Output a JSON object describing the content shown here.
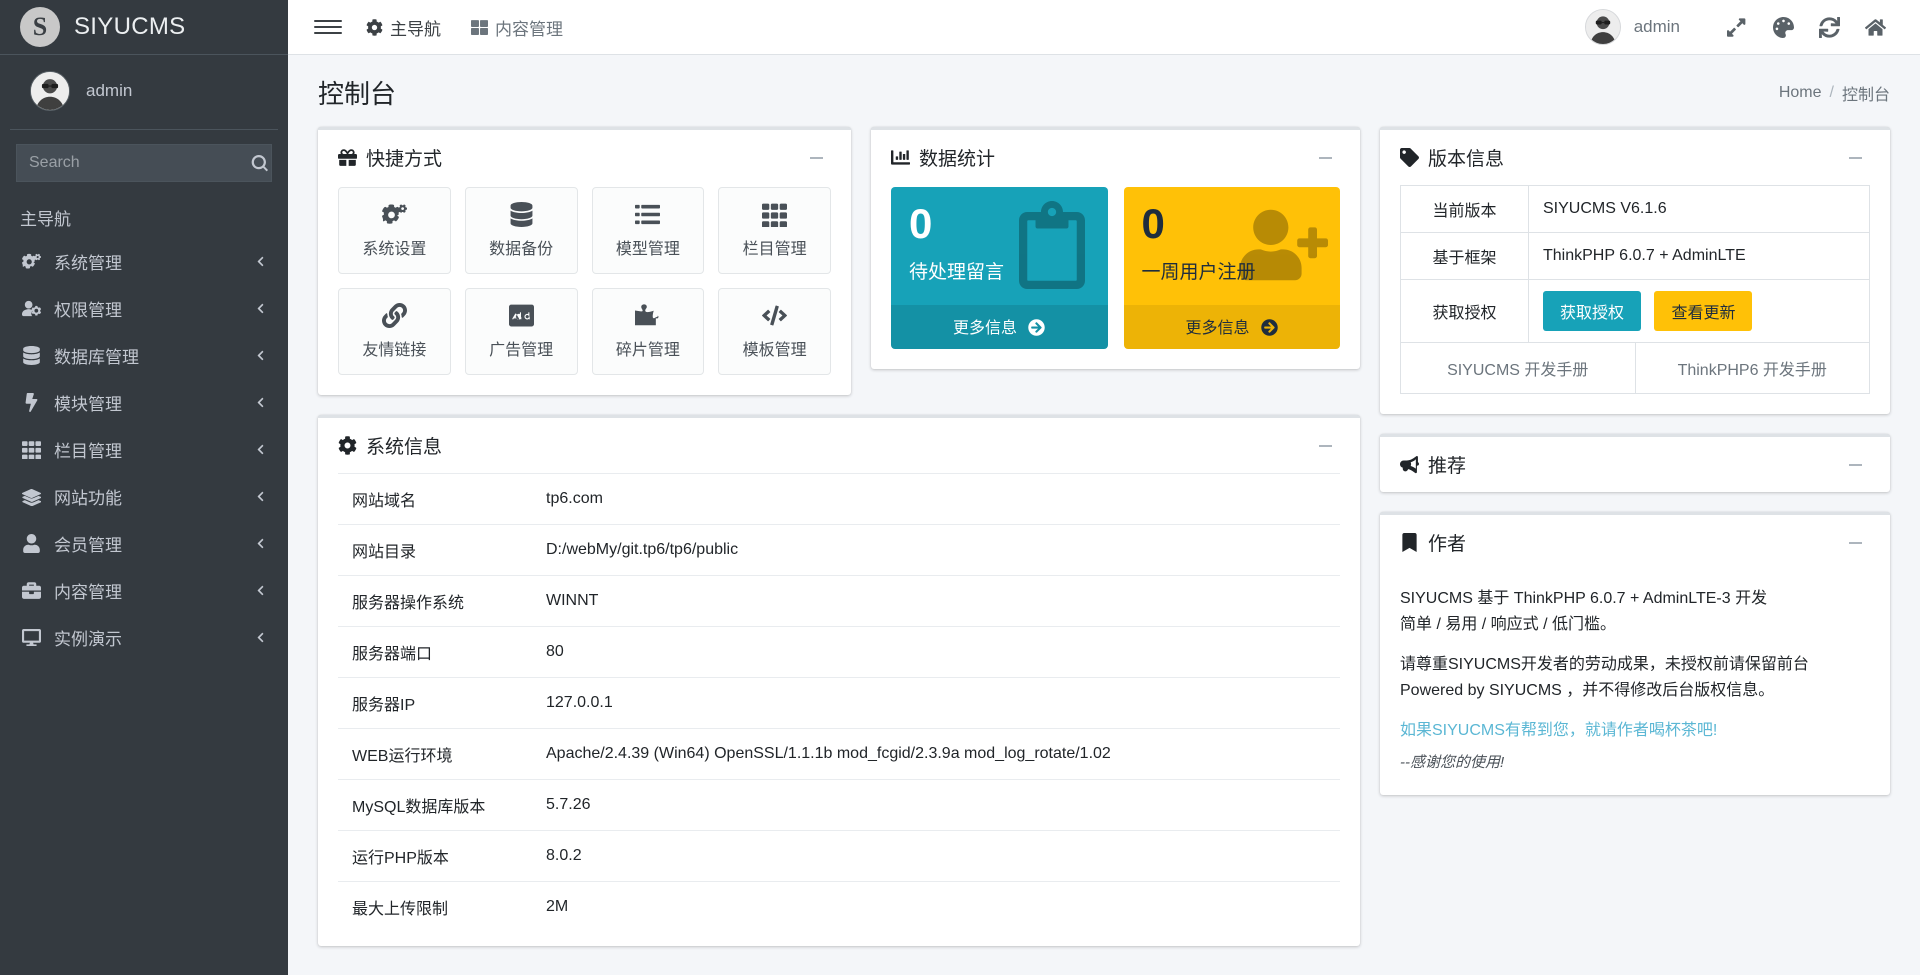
{
  "brand": {
    "logo_letter": "S",
    "name": "SIYUCMS"
  },
  "sidebar": {
    "user": {
      "name": "admin"
    },
    "search": {
      "placeholder": "Search",
      "value": "",
      "icon": "search-icon"
    },
    "nav_header": "主导航",
    "items": [
      {
        "label": "系统管理",
        "icon": "cogs-icon",
        "chevron": "chevron-left-icon"
      },
      {
        "label": "权限管理",
        "icon": "user-cog-icon",
        "chevron": "chevron-left-icon"
      },
      {
        "label": "数据库管理",
        "icon": "database-icon",
        "chevron": "chevron-left-icon"
      },
      {
        "label": "模块管理",
        "icon": "bolt-icon",
        "chevron": "chevron-left-icon"
      },
      {
        "label": "栏目管理",
        "icon": "grid-icon",
        "chevron": "chevron-left-icon"
      },
      {
        "label": "网站功能",
        "icon": "layers-icon",
        "chevron": "chevron-left-icon"
      },
      {
        "label": "会员管理",
        "icon": "user-icon",
        "chevron": "chevron-left-icon"
      },
      {
        "label": "内容管理",
        "icon": "briefcase-icon",
        "chevron": "chevron-left-icon"
      },
      {
        "label": "实例演示",
        "icon": "desktop-icon",
        "chevron": "chevron-left-icon"
      }
    ]
  },
  "topnav": {
    "menu_toggle": "hamburger-icon",
    "items": [
      {
        "label": "主导航",
        "icon": "gear-icon"
      },
      {
        "label": "内容管理",
        "icon": "th-large-icon"
      }
    ],
    "user": "admin",
    "actions": [
      {
        "name": "fullscreen-icon"
      },
      {
        "name": "palette-icon"
      },
      {
        "name": "refresh-icon"
      },
      {
        "name": "home-icon"
      }
    ]
  },
  "page": {
    "title": "控制台",
    "breadcrumb": {
      "home": "Home",
      "sep": "/",
      "current": "控制台"
    }
  },
  "shortcuts": {
    "title": "快捷方式",
    "title_icon": "gift-icon",
    "collapse": "minus-icon",
    "items": [
      {
        "label": "系统设置",
        "icon": "cogs-icon"
      },
      {
        "label": "数据备份",
        "icon": "database-icon"
      },
      {
        "label": "模型管理",
        "icon": "list-icon"
      },
      {
        "label": "栏目管理",
        "icon": "grid-icon"
      },
      {
        "label": "友情链接",
        "icon": "link-icon"
      },
      {
        "label": "广告管理",
        "icon": "ad-icon"
      },
      {
        "label": "碎片管理",
        "icon": "puzzle-icon"
      },
      {
        "label": "模板管理",
        "icon": "code-icon"
      }
    ]
  },
  "stats": {
    "title": "数据统计",
    "title_icon": "chart-bar-icon",
    "collapse": "minus-icon",
    "boxes": [
      {
        "value": "0",
        "label": "待处理留言",
        "footer": "更多信息",
        "footer_icon": "arrow-circle-right-icon",
        "color": "#17a2b8",
        "icon": "clipboard-icon"
      },
      {
        "value": "0",
        "label": "一周用户注册",
        "footer": "更多信息",
        "footer_icon": "arrow-circle-right-icon",
        "color": "#ffc107",
        "icon": "user-plus-icon"
      }
    ]
  },
  "version": {
    "title": "版本信息",
    "title_icon": "tag-icon",
    "collapse": "minus-icon",
    "rows": [
      {
        "label": "当前版本",
        "value": "SIYUCMS V6.1.6"
      },
      {
        "label": "基于框架",
        "value": "ThinkPHP 6.0.7 + AdminLTE"
      }
    ],
    "license_label": "获取授权",
    "license_button": "获取授权",
    "update_button": "查看更新",
    "manuals": [
      "SIYUCMS 开发手册",
      "ThinkPHP6 开发手册"
    ]
  },
  "sysinfo": {
    "title": "系统信息",
    "title_icon": "gear-icon",
    "collapse": "minus-icon",
    "rows": [
      {
        "key": "网站域名",
        "value": "tp6.com"
      },
      {
        "key": "网站目录",
        "value": "D:/webMy/git.tp6/tp6/public"
      },
      {
        "key": "服务器操作系统",
        "value": "WINNT"
      },
      {
        "key": "服务器端口",
        "value": "80"
      },
      {
        "key": "服务器IP",
        "value": "127.0.0.1"
      },
      {
        "key": "WEB运行环境",
        "value": "Apache/2.4.39 (Win64) OpenSSL/1.1.1b mod_fcgid/2.3.9a mod_log_rotate/1.02"
      },
      {
        "key": "MySQL数据库版本",
        "value": "5.7.26"
      },
      {
        "key": "运行PHP版本",
        "value": "8.0.2"
      },
      {
        "key": "最大上传限制",
        "value": "2M"
      }
    ]
  },
  "recommend": {
    "title": "推荐",
    "title_icon": "bullhorn-icon",
    "collapse": "minus-icon"
  },
  "author": {
    "title": "作者",
    "title_icon": "bookmark-icon",
    "collapse": "minus-icon",
    "line1": "SIYUCMS 基于 ThinkPHP 6.0.7 + AdminLTE-3 开发",
    "line2": "简单 / 易用 / 响应式 / 低门槛。",
    "paragraph": "请尊重SIYUCMS开发者的劳动成果，未授权前请保留前台 Powered by SIYUCMS ，并不得修改后台版权信息。",
    "link": "如果SIYUCMS有帮到您，就请作者喝杯茶吧!",
    "thanks": "--感谢您的使用!"
  },
  "colors": {
    "sidebar_bg": "#343a40",
    "teal": "#17a2b8",
    "yellow": "#ffc107",
    "page_bg": "#f4f6f9",
    "link": "#5bb7d4"
  }
}
